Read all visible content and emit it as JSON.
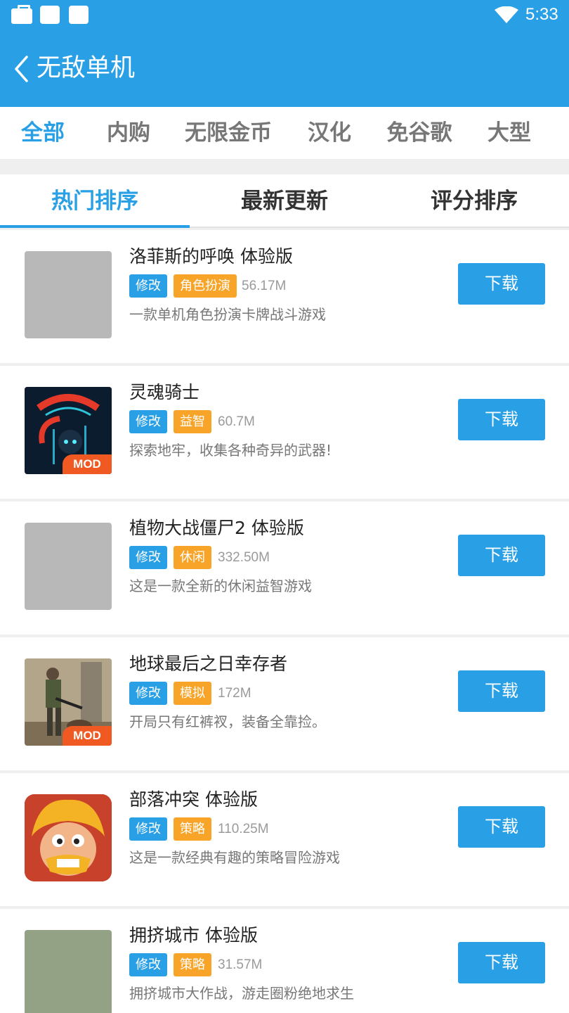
{
  "status_bar": {
    "time": "5:33"
  },
  "toolbar": {
    "title": "无敌单机"
  },
  "categories": [
    {
      "label": "全部",
      "active": true
    },
    {
      "label": "内购",
      "active": false
    },
    {
      "label": "无限金币",
      "active": false
    },
    {
      "label": "汉化",
      "active": false
    },
    {
      "label": "免谷歌",
      "active": false
    },
    {
      "label": "大型",
      "active": false
    }
  ],
  "sort_tabs": [
    {
      "label": "热门排序",
      "active": true
    },
    {
      "label": "最新更新",
      "active": false
    },
    {
      "label": "评分排序",
      "active": false
    }
  ],
  "colors": {
    "accent": "#29a0e6",
    "tag_orange": "#f7a428",
    "mod_badge": "#f05a22"
  },
  "apps": [
    {
      "name": "洛菲斯的呼唤 体验版",
      "tag1": "修改",
      "tag2": "角色扮演",
      "size": "56.17M",
      "desc": "一款单机角色扮演卡牌战斗游戏",
      "button": "下载",
      "icon": "placeholder-icon"
    },
    {
      "name": "灵魂骑士",
      "tag1": "修改",
      "tag2": "益智",
      "size": "60.7M",
      "desc": "探索地牢，收集各种奇异的武器!",
      "button": "下载",
      "icon": "soul-knight-icon",
      "badge": "MOD"
    },
    {
      "name": "植物大战僵尸2 体验版",
      "tag1": "修改",
      "tag2": "休闲",
      "size": "332.50M",
      "desc": "这是一款全新的休闲益智游戏",
      "button": "下载",
      "icon": "placeholder-icon"
    },
    {
      "name": "地球最后之日幸存者",
      "tag1": "修改",
      "tag2": "模拟",
      "size": "172M",
      "desc": "开局只有红裤衩，装备全靠捡。",
      "button": "下载",
      "icon": "survivor-icon",
      "badge": "MOD"
    },
    {
      "name": "部落冲突 体验版",
      "tag1": "修改",
      "tag2": "策略",
      "size": "110.25M",
      "desc": "这是一款经典有趣的策略冒险游戏",
      "button": "下载",
      "icon": "barbarian-icon"
    },
    {
      "name": "拥挤城市 体验版",
      "tag1": "修改",
      "tag2": "策略",
      "size": "31.57M",
      "desc": "拥挤城市大作战，游走圈粉绝地求生",
      "button": "下载",
      "icon": "placeholder-green-icon"
    }
  ]
}
